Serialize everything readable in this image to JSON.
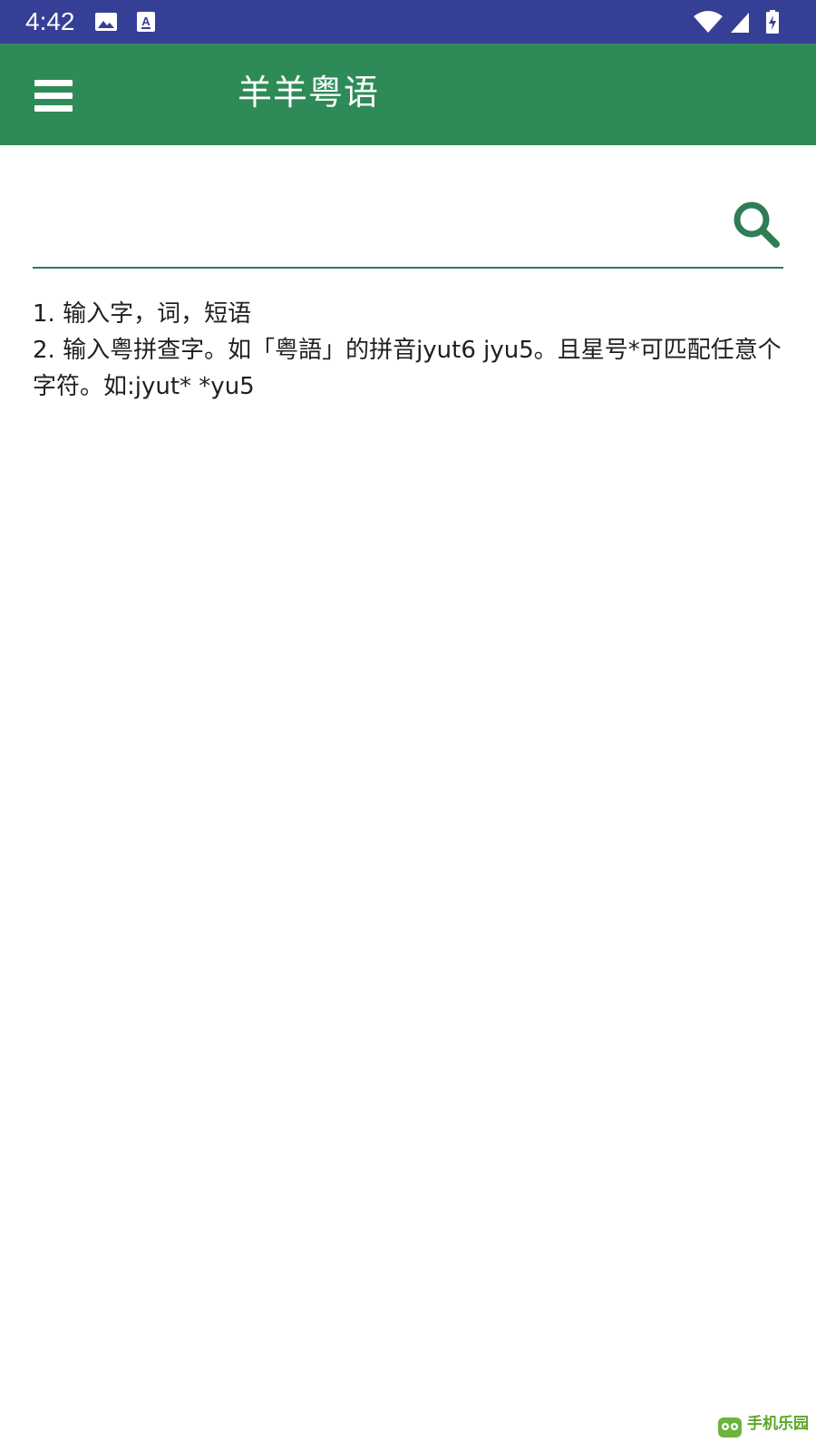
{
  "status_bar": {
    "time": "4:42",
    "left_icons": [
      "image-icon",
      "accessibility-a-icon"
    ],
    "right_icons": [
      "wifi-icon",
      "cell-signal-icon",
      "battery-charging-icon"
    ]
  },
  "app_bar": {
    "title": "羊羊粤语",
    "menu_icon": "hamburger-menu-icon",
    "background_color": "#2e8b57"
  },
  "search": {
    "value": "",
    "placeholder": "",
    "icon": "search-icon"
  },
  "help": {
    "line1": "1. 输入字，词，短语",
    "line2": "2. 输入粤拼查字。如「粤語」的拼音jyut6  jyu5。且星号*可匹配任意个字符。如:jyut*  *yu5"
  },
  "watermark": {
    "text": "手机乐园"
  },
  "colors": {
    "status_bar": "#353f95",
    "accent": "#2e8b57"
  }
}
